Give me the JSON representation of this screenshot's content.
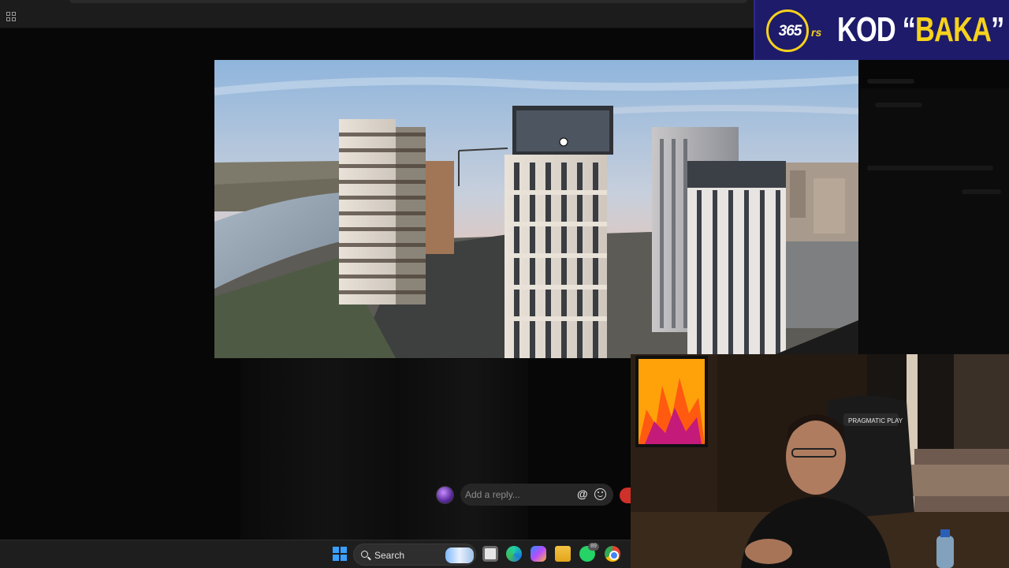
{
  "browser": {
    "apps_icon": "grid-icon"
  },
  "viewer": {
    "image_subject": "high-rise residential towers beside a river at sunset",
    "cursor_icon": "hand-pointer-icon"
  },
  "reply": {
    "placeholder": "Add a reply...",
    "mention_symbol": "@",
    "emoji_icon": "smile-icon"
  },
  "taskbar": {
    "search_label": "Search",
    "apps": [
      "windows-start-icon",
      "task-view-icon",
      "edge-icon",
      "copilot-icon",
      "file-explorer-icon",
      "whatsapp-icon",
      "chrome-icon"
    ],
    "whatsapp_badge": "89"
  },
  "banner": {
    "logo_number": "365",
    "logo_suffix": "rs",
    "title_prefix": "KOD “",
    "title_highlight": "BAKA",
    "title_suffix": "”",
    "colors": {
      "background": "#1e1b6a",
      "accent": "#f6d21c"
    }
  },
  "webcam": {
    "chair_brand": "PRAGMATIC PLAY"
  }
}
